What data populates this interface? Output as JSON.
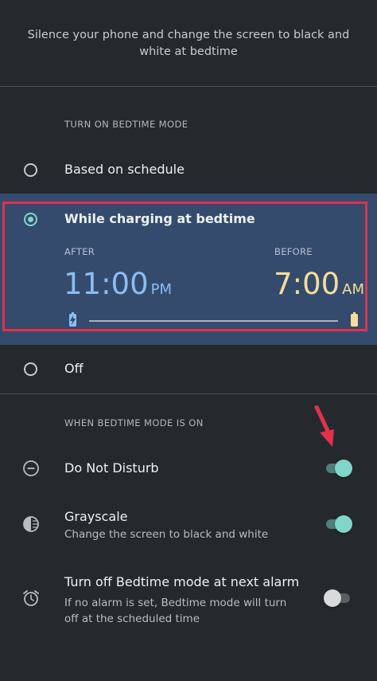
{
  "intro_text": "Silence your phone and change the screen to black and white at bedtime",
  "turn_on_section": {
    "header": "TURN ON BEDTIME MODE",
    "options": [
      {
        "label": "Based on schedule",
        "selected": false
      },
      {
        "label": "While charging at bedtime",
        "selected": true
      },
      {
        "label": "Off",
        "selected": false
      }
    ]
  },
  "charging_window": {
    "after_label": "AFTER",
    "after_time": "11:00",
    "after_ampm": "PM",
    "before_label": "BEFORE",
    "before_time": "7:00",
    "before_ampm": "AM"
  },
  "when_on_section": {
    "header": "WHEN BEDTIME MODE IS ON",
    "settings": [
      {
        "title": "Do Not Disturb",
        "subtitle": "",
        "enabled": true,
        "icon": "do-not-disturb-icon"
      },
      {
        "title": "Grayscale",
        "subtitle": "Change the screen to black and white",
        "enabled": true,
        "icon": "grayscale-icon"
      },
      {
        "title": "Turn off Bedtime mode at next alarm",
        "subtitle": "If no alarm is set, Bedtime mode will turn off at the scheduled time",
        "enabled": false,
        "icon": "alarm-clock-icon"
      }
    ]
  },
  "colors": {
    "background": "#25292d",
    "highlight_panel": "#344b6d",
    "accent_teal": "#7fd6c9",
    "after_blue": "#8bbdf3",
    "before_yellow": "#f5dd9a",
    "annotation_red": "#e0324b"
  }
}
